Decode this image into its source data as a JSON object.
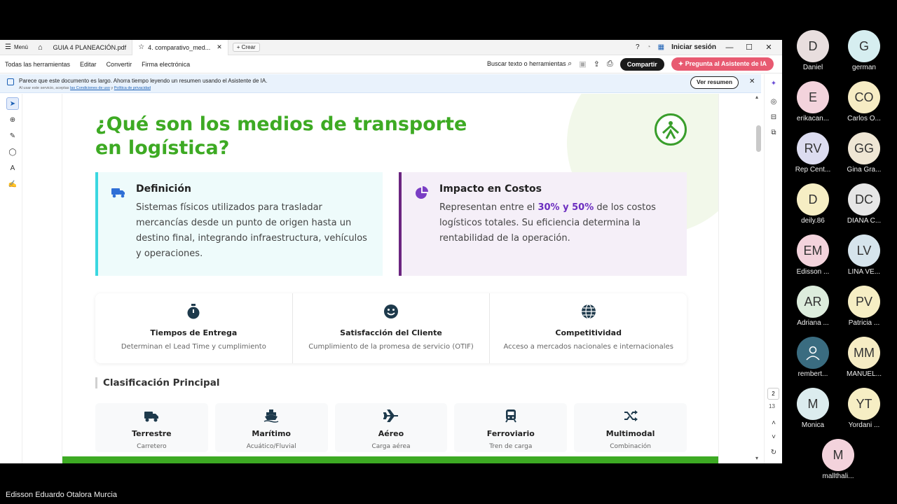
{
  "tabbar": {
    "menu_label": "Menú",
    "tabs": [
      {
        "label": "GUIA 4 PLANEACIÓN.pdf"
      },
      {
        "label": "4. comparativo_med..."
      }
    ],
    "create_label": "Crear",
    "signin_label": "Iniciar sesión"
  },
  "menubar": {
    "items": [
      "Todas las herramientas",
      "Editar",
      "Convertir",
      "Firma electrónica"
    ],
    "search_label": "Buscar texto o herramientas",
    "share_label": "Compartir",
    "ai_label": "Pregunta al Asistente de IA"
  },
  "infobar": {
    "message": "Parece que este documento es largo. Ahorra tiempo leyendo un resumen usando el Asistente de IA.",
    "legal_prefix": "Al usar este servicio, aceptas",
    "legal_terms": "las Condiciones de uso",
    "legal_and": "y",
    "legal_privacy": "Política de privacidad",
    "summary_button": "Ver resumen"
  },
  "viewer": {
    "current_page": "2",
    "total_pages": "13"
  },
  "document": {
    "title_line1": "¿Qué son los medios de transporte",
    "title_line2": "en logística?",
    "logo_text": "SENA",
    "definition": {
      "title": "Definición",
      "body": "Sistemas físicos utilizados para trasladar mercancías desde un punto de origen hasta un destino final, integrando infraestructura, vehículos y operaciones."
    },
    "cost": {
      "title": "Impacto en Costos",
      "body_pre": "Representan entre el ",
      "body_highlight": "30% y 50%",
      "body_post": " de los costos logísticos totales. Su eficiencia determina la rentabilidad de la operación."
    },
    "metrics": [
      {
        "title": "Tiempos de Entrega",
        "desc": "Determinan el Lead Time y cumplimiento"
      },
      {
        "title": "Satisfacción del Cliente",
        "desc": "Cumplimiento de la promesa de servicio (OTIF)"
      },
      {
        "title": "Competitividad",
        "desc": "Acceso a mercados nacionales e internacionales"
      }
    ],
    "section_title": "Clasificación Principal",
    "modes": [
      {
        "title": "Terrestre",
        "sub": "Carretero"
      },
      {
        "title": "Marítimo",
        "sub": "Acuático/Fluvial"
      },
      {
        "title": "Aéreo",
        "sub": "Carga aérea"
      },
      {
        "title": "Ferroviario",
        "sub": "Tren de carga"
      },
      {
        "title": "Multimodal",
        "sub": "Combinación"
      }
    ],
    "colors": {
      "green": "#3daa23",
      "cyan": "#3ad7e0",
      "purple": "#6b2580"
    }
  },
  "participants": [
    {
      "initials": "D",
      "name": "Daniel",
      "color": "#e8dede"
    },
    {
      "initials": "G",
      "name": "german",
      "color": "#d6eef0"
    },
    {
      "initials": "E",
      "name": "erikacan...",
      "color": "#f3d3dc"
    },
    {
      "initials": "CO",
      "name": "Carlos O...",
      "color": "#f6ecc4"
    },
    {
      "initials": "RV",
      "name": "Rep Cent...",
      "color": "#dcdcf0"
    },
    {
      "initials": "GG",
      "name": "Gina Gra...",
      "color": "#efe6d4"
    },
    {
      "initials": "D",
      "name": "deily.86",
      "color": "#f6eec4"
    },
    {
      "initials": "DC",
      "name": "DIANA C...",
      "color": "#e6e6e6"
    },
    {
      "initials": "EM",
      "name": "Edisson ...",
      "color": "#f3d3dc"
    },
    {
      "initials": "LV",
      "name": "LINA VE...",
      "color": "#d6e4ec"
    },
    {
      "initials": "AR",
      "name": "Adriana ...",
      "color": "#dcecdc"
    },
    {
      "initials": "PV",
      "name": "Patricia ...",
      "color": "#f6eec4"
    },
    {
      "initials": "",
      "name": "rembert...",
      "color": "#3a6c80"
    },
    {
      "initials": "MM",
      "name": "MANUEL...",
      "color": "#f6ecc4"
    },
    {
      "initials": "M",
      "name": "Monica",
      "color": "#dcecee"
    },
    {
      "initials": "YT",
      "name": "Yordani ...",
      "color": "#f6eec4"
    },
    {
      "initials": "M",
      "name": "mallthali...",
      "color": "#f3d3dc"
    }
  ],
  "presenter_name": "Edisson Eduardo Otalora Murcia"
}
